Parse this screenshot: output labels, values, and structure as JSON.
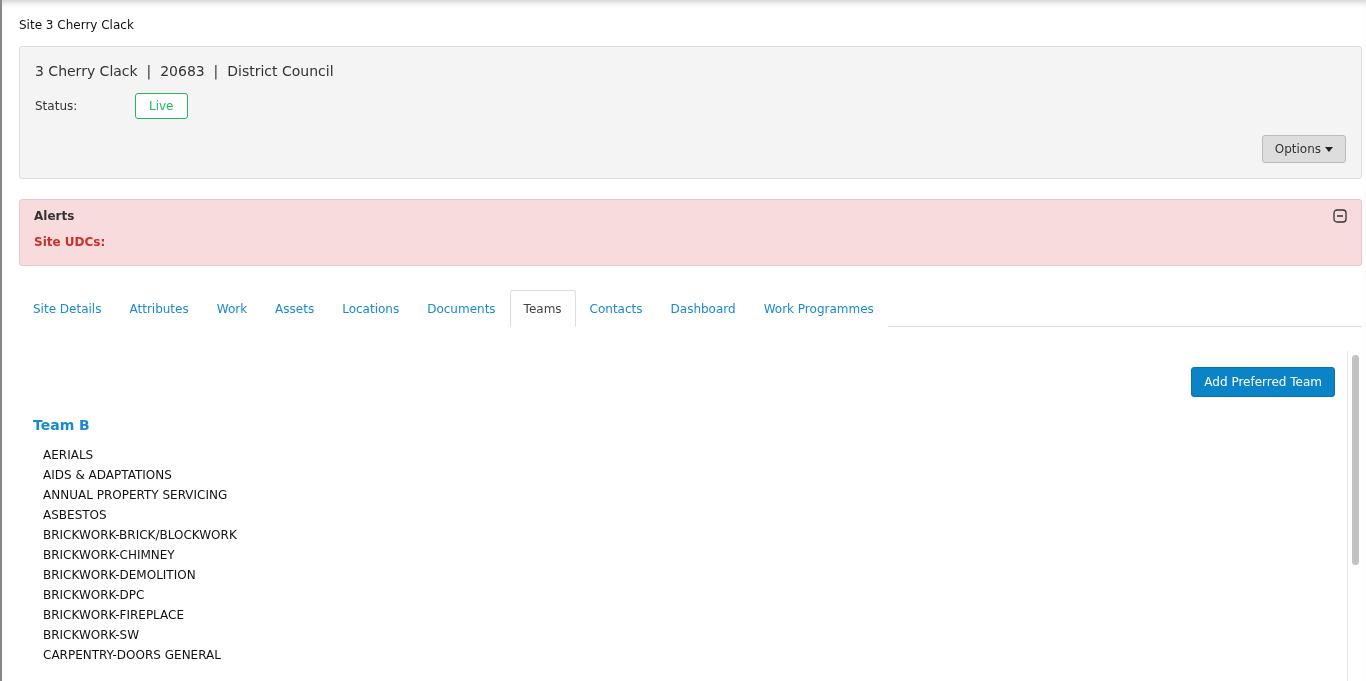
{
  "page_title": "Site 3 Cherry Clack",
  "header": {
    "heading": "3 Cherry Clack  |  20683  |  District Council",
    "status_label": "Status:",
    "status": "Live",
    "options_button": "Options"
  },
  "alerts": {
    "title": "Alerts",
    "expanded": true,
    "items": [
      "Site UDCs:"
    ]
  },
  "tabs": [
    {
      "label": "Site Details",
      "selected": false
    },
    {
      "label": "Attributes",
      "selected": false
    },
    {
      "label": "Work",
      "selected": false
    },
    {
      "label": "Assets",
      "selected": false
    },
    {
      "label": "Locations",
      "selected": false
    },
    {
      "label": "Documents",
      "selected": false
    },
    {
      "label": "Teams",
      "selected": true
    },
    {
      "label": "Contacts",
      "selected": false
    },
    {
      "label": "Dashboard",
      "selected": false
    },
    {
      "label": "Work Programmes",
      "selected": false
    }
  ],
  "add_button": "Add Preferred Team",
  "team": {
    "name": "Team B",
    "trades": [
      "AERIALS",
      "AIDS & ADAPTATIONS",
      "ANNUAL PROPERTY SERVICING",
      "ASBESTOS",
      "BRICKWORK-BRICK/BLOCKWORK",
      "BRICKWORK-CHIMNEY",
      "BRICKWORK-DEMOLITION",
      "BRICKWORK-DPC",
      "BRICKWORK-FIREPLACE",
      "BRICKWORK-SW",
      "CARPENTRY-DOORS GENERAL"
    ]
  }
}
